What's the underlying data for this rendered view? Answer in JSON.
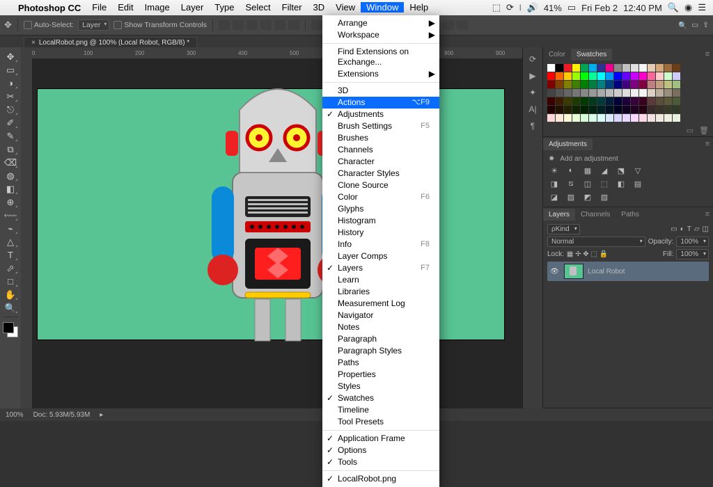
{
  "menubar": {
    "app": "Photoshop CC",
    "items": [
      "File",
      "Edit",
      "Image",
      "Layer",
      "Type",
      "Select",
      "Filter",
      "3D",
      "View",
      "Window",
      "Help"
    ],
    "active": "Window",
    "right": {
      "battery": "41%",
      "date": "Fri Feb 2",
      "time": "12:40 PM"
    }
  },
  "options": {
    "autoselect": "Auto-Select:",
    "layer": "Layer",
    "transform": "Show Transform Controls"
  },
  "tab": {
    "title": "LocalRobot.png @ 100% (Local Robot, RGB/8) *"
  },
  "dropdown": [
    {
      "label": "Arrange",
      "sub": true
    },
    {
      "label": "Workspace",
      "sub": true
    },
    {
      "sep": true
    },
    {
      "label": "Find Extensions on Exchange..."
    },
    {
      "label": "Extensions",
      "sub": true
    },
    {
      "sep": true
    },
    {
      "label": "3D"
    },
    {
      "label": "Actions",
      "shortcut": "⌥F9",
      "hl": true
    },
    {
      "label": "Adjustments",
      "chk": true
    },
    {
      "label": "Brush Settings",
      "shortcut": "F5"
    },
    {
      "label": "Brushes"
    },
    {
      "label": "Channels"
    },
    {
      "label": "Character"
    },
    {
      "label": "Character Styles"
    },
    {
      "label": "Clone Source"
    },
    {
      "label": "Color",
      "shortcut": "F6"
    },
    {
      "label": "Glyphs"
    },
    {
      "label": "Histogram"
    },
    {
      "label": "History"
    },
    {
      "label": "Info",
      "shortcut": "F8"
    },
    {
      "label": "Layer Comps"
    },
    {
      "label": "Layers",
      "shortcut": "F7",
      "chk": true
    },
    {
      "label": "Learn"
    },
    {
      "label": "Libraries"
    },
    {
      "label": "Measurement Log"
    },
    {
      "label": "Navigator"
    },
    {
      "label": "Notes"
    },
    {
      "label": "Paragraph"
    },
    {
      "label": "Paragraph Styles"
    },
    {
      "label": "Paths"
    },
    {
      "label": "Properties"
    },
    {
      "label": "Styles"
    },
    {
      "label": "Swatches",
      "chk": true
    },
    {
      "label": "Timeline"
    },
    {
      "label": "Tool Presets"
    },
    {
      "sep": true
    },
    {
      "label": "Application Frame",
      "chk": true
    },
    {
      "label": "Options",
      "chk": true
    },
    {
      "label": "Tools",
      "chk": true
    },
    {
      "sep": true
    },
    {
      "label": "LocalRobot.png",
      "chk": true
    }
  ],
  "panels": {
    "color": {
      "tabs": [
        "Color",
        "Swatches"
      ],
      "active": "Swatches"
    },
    "adjust": {
      "title": "Adjustments",
      "hint": "Add an adjustment"
    },
    "layers": {
      "tabs": [
        "Layers",
        "Channels",
        "Paths"
      ],
      "active": "Layers",
      "kind": "ρKind",
      "blend": "Normal",
      "opacity_lbl": "Opacity:",
      "opacity": "100%",
      "lock_lbl": "Lock:",
      "fill_lbl": "Fill:",
      "fill": "100%",
      "layer_name": "Local Robot"
    }
  },
  "status": {
    "zoom": "100%",
    "doc": "Doc: 5.93M/5.93M"
  },
  "swatch_colors": [
    "#ffffff",
    "#000000",
    "#ed1c24",
    "#fff200",
    "#00a651",
    "#00aeef",
    "#2e3192",
    "#ec008c",
    "#898989",
    "#c0c0c0",
    "#e0e0e0",
    "#f5f5f5",
    "#e6cbb3",
    "#d2a679",
    "#9e6b3a",
    "#6b3e19",
    "#ff0000",
    "#ff6600",
    "#ffcc00",
    "#99ff00",
    "#00ff00",
    "#00ff99",
    "#00ffff",
    "#0099ff",
    "#0000ff",
    "#6600ff",
    "#cc00ff",
    "#ff00cc",
    "#ff6699",
    "#ffcccc",
    "#ccffcc",
    "#ccccff",
    "#800000",
    "#804000",
    "#808000",
    "#408000",
    "#008000",
    "#008040",
    "#008080",
    "#004080",
    "#000080",
    "#400080",
    "#800080",
    "#800040",
    "#c08080",
    "#c0a080",
    "#c0c080",
    "#a0c080",
    "#444444",
    "#555555",
    "#666666",
    "#777777",
    "#888888",
    "#999999",
    "#aaaaaa",
    "#bbbbbb",
    "#cccccc",
    "#dddddd",
    "#eeeeee",
    "#f4f4f4",
    "#dcd0c0",
    "#bcae9c",
    "#9c8e7c",
    "#7c6e5c",
    "#3a0000",
    "#3a1d00",
    "#3a3a00",
    "#1d3a00",
    "#003a00",
    "#003a1d",
    "#003a3a",
    "#001d3a",
    "#00003a",
    "#1d003a",
    "#3a003a",
    "#3a001d",
    "#5a3a3a",
    "#5a4d3a",
    "#5a5a3a",
    "#4d5a3a",
    "#220000",
    "#221100",
    "#222200",
    "#112200",
    "#002200",
    "#002211",
    "#002222",
    "#001122",
    "#000022",
    "#110022",
    "#220022",
    "#220011",
    "#3a2a2a",
    "#3a332a",
    "#3a3a2a",
    "#333a2a",
    "#ffd7d7",
    "#ffe8d7",
    "#fff9d7",
    "#e8ffd7",
    "#d7ffd7",
    "#d7ffe8",
    "#d7fff9",
    "#d7e8ff",
    "#d7d7ff",
    "#e8d7ff",
    "#f9d7ff",
    "#ffd7e8",
    "#f0e0e0",
    "#f0e8e0",
    "#f0f0e0",
    "#e8f0e0"
  ],
  "tools": [
    "✥",
    "▭",
    "◑",
    "✂",
    "⎋",
    "✐",
    "✎",
    "⧉",
    "⌫",
    "◍",
    "◧",
    "⊕",
    "⬳",
    "⌁",
    "△",
    "T",
    "⬀",
    "□",
    "✋",
    "🔍"
  ]
}
